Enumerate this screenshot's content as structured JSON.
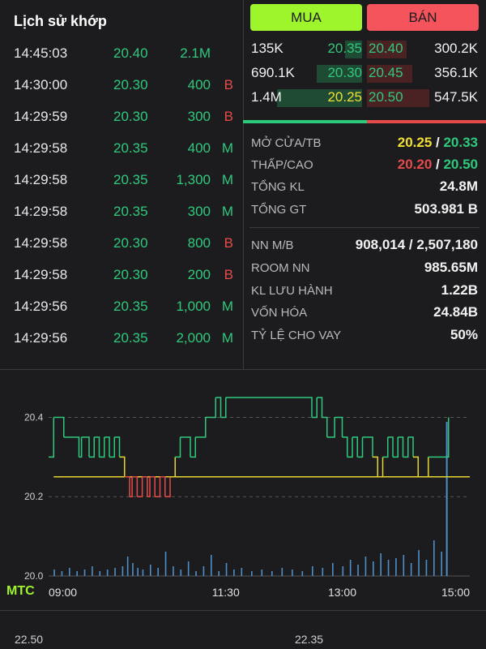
{
  "history": {
    "title": "Lịch sử khớp",
    "rows": [
      {
        "time": "14:45:03",
        "price": "20.40",
        "vol": "2.1M",
        "side": "",
        "vcolor": "green",
        "scolor": ""
      },
      {
        "time": "14:30:00",
        "price": "20.30",
        "vol": "400",
        "side": "B",
        "vcolor": "green",
        "scolor": "red"
      },
      {
        "time": "14:29:59",
        "price": "20.30",
        "vol": "300",
        "side": "B",
        "vcolor": "green",
        "scolor": "red"
      },
      {
        "time": "14:29:58",
        "price": "20.35",
        "vol": "400",
        "side": "M",
        "vcolor": "green",
        "scolor": "green"
      },
      {
        "time": "14:29:58",
        "price": "20.35",
        "vol": "1,300",
        "side": "M",
        "vcolor": "green",
        "scolor": "green"
      },
      {
        "time": "14:29:58",
        "price": "20.35",
        "vol": "300",
        "side": "M",
        "vcolor": "green",
        "scolor": "green"
      },
      {
        "time": "14:29:58",
        "price": "20.30",
        "vol": "800",
        "side": "B",
        "vcolor": "green",
        "scolor": "red"
      },
      {
        "time": "14:29:58",
        "price": "20.30",
        "vol": "200",
        "side": "B",
        "vcolor": "green",
        "scolor": "red"
      },
      {
        "time": "14:29:56",
        "price": "20.35",
        "vol": "1,000",
        "side": "M",
        "vcolor": "green",
        "scolor": "green"
      },
      {
        "time": "14:29:56",
        "price": "20.35",
        "vol": "2,000",
        "side": "M",
        "vcolor": "green",
        "scolor": "green"
      }
    ]
  },
  "buttons": {
    "buy": "MUA",
    "sell": "BÁN"
  },
  "orderbook": [
    {
      "bid_vol": "135K",
      "bid": "20.35",
      "ask": "20.40",
      "ask_vol": "300.2K",
      "bid_bar": 0.15,
      "ask_bar": 0.35
    },
    {
      "bid_vol": "690.1K",
      "bid": "20.30",
      "ask": "20.45",
      "ask_vol": "356.1K",
      "bid_bar": 0.4,
      "ask_bar": 0.4
    },
    {
      "bid_vol": "1.4M",
      "bid": "20.25",
      "ask": "20.50",
      "ask_vol": "547.5K",
      "bid_bar": 0.75,
      "ask_bar": 0.55
    }
  ],
  "stats": {
    "open_avg": {
      "label": "MỞ CỬA/TB",
      "a": "20.25",
      "sep": " / ",
      "b": "20.33"
    },
    "low_high": {
      "label": "THẤP/CAO",
      "a": "20.20",
      "sep": " / ",
      "b": "20.50"
    },
    "total_vol": {
      "label": "TỔNG KL",
      "value": "24.8M"
    },
    "total_val": {
      "label": "TỔNG GT",
      "value": "503.981 B"
    },
    "foreign": {
      "label": "NN M/B",
      "value": "908,014 / 2,507,180"
    },
    "room": {
      "label": "ROOM NN",
      "value": "985.65M"
    },
    "outstanding": {
      "label": "KL LƯU HÀNH",
      "value": "1.22B"
    },
    "market_cap": {
      "label": "VỐN HÓA",
      "value": "24.84B"
    },
    "lending": {
      "label": "TỶ LỆ CHO VAY",
      "value": "50%"
    }
  },
  "chart_data": {
    "type": "line",
    "ylim": [
      20.0,
      20.45
    ],
    "y_ticks": [
      "20.4",
      "20.2",
      "20.0"
    ],
    "x_ticks": [
      "09:00",
      "11:30",
      "13:00",
      "15:00"
    ],
    "reference_price": 20.25,
    "price_series": [
      [
        0,
        20.3
      ],
      [
        2,
        20.4
      ],
      [
        5,
        20.4
      ],
      [
        6,
        20.35
      ],
      [
        10,
        20.35
      ],
      [
        12,
        20.3
      ],
      [
        13,
        20.35
      ],
      [
        16,
        20.3
      ],
      [
        18,
        20.35
      ],
      [
        20,
        20.3
      ],
      [
        22,
        20.35
      ],
      [
        24,
        20.3
      ],
      [
        26,
        20.35
      ],
      [
        28,
        20.3
      ],
      [
        30,
        20.25
      ],
      [
        32,
        20.2
      ],
      [
        33,
        20.25
      ],
      [
        35,
        20.2
      ],
      [
        37,
        20.25
      ],
      [
        39,
        20.2
      ],
      [
        40,
        20.25
      ],
      [
        42,
        20.2
      ],
      [
        44,
        20.25
      ],
      [
        46,
        20.2
      ],
      [
        48,
        20.25
      ],
      [
        50,
        20.3
      ],
      [
        52,
        20.35
      ],
      [
        54,
        20.35
      ],
      [
        56,
        20.3
      ],
      [
        58,
        20.35
      ],
      [
        60,
        20.35
      ],
      [
        62,
        20.4
      ],
      [
        64,
        20.4
      ],
      [
        66,
        20.45
      ],
      [
        68,
        20.4
      ],
      [
        70,
        20.45
      ],
      [
        72,
        20.45
      ],
      [
        100,
        20.45
      ],
      [
        103,
        20.45
      ],
      [
        104,
        20.4
      ],
      [
        106,
        20.45
      ],
      [
        108,
        20.4
      ],
      [
        110,
        20.35
      ],
      [
        113,
        20.4
      ],
      [
        116,
        20.35
      ],
      [
        118,
        20.3
      ],
      [
        120,
        20.35
      ],
      [
        122,
        20.3
      ],
      [
        124,
        20.35
      ],
      [
        128,
        20.3
      ],
      [
        130,
        20.25
      ],
      [
        132,
        20.3
      ],
      [
        134,
        20.35
      ],
      [
        136,
        20.3
      ],
      [
        138,
        20.35
      ],
      [
        140,
        20.3
      ],
      [
        142,
        20.35
      ],
      [
        144,
        20.3
      ],
      [
        146,
        20.25
      ],
      [
        150,
        20.3
      ],
      [
        158,
        20.4
      ]
    ],
    "volume_bars": [
      [
        2,
        4
      ],
      [
        5,
        3
      ],
      [
        8,
        5
      ],
      [
        11,
        3
      ],
      [
        14,
        4
      ],
      [
        17,
        6
      ],
      [
        20,
        3
      ],
      [
        23,
        4
      ],
      [
        26,
        5
      ],
      [
        29,
        6
      ],
      [
        31,
        12
      ],
      [
        33,
        8
      ],
      [
        35,
        5
      ],
      [
        37,
        4
      ],
      [
        40,
        7
      ],
      [
        43,
        5
      ],
      [
        46,
        15
      ],
      [
        49,
        6
      ],
      [
        52,
        4
      ],
      [
        55,
        9
      ],
      [
        58,
        3
      ],
      [
        61,
        6
      ],
      [
        64,
        13
      ],
      [
        67,
        3
      ],
      [
        70,
        8
      ],
      [
        73,
        4
      ],
      [
        76,
        5
      ],
      [
        80,
        3
      ],
      [
        84,
        4
      ],
      [
        88,
        3
      ],
      [
        92,
        5
      ],
      [
        96,
        4
      ],
      [
        100,
        3
      ],
      [
        104,
        6
      ],
      [
        108,
        5
      ],
      [
        112,
        8
      ],
      [
        116,
        6
      ],
      [
        119,
        10
      ],
      [
        122,
        7
      ],
      [
        125,
        12
      ],
      [
        128,
        9
      ],
      [
        131,
        14
      ],
      [
        134,
        10
      ],
      [
        137,
        11
      ],
      [
        140,
        13
      ],
      [
        143,
        8
      ],
      [
        146,
        16
      ],
      [
        149,
        10
      ],
      [
        152,
        22
      ],
      [
        155,
        15
      ],
      [
        157,
        60
      ]
    ]
  },
  "mtc": "MTC",
  "bottom": {
    "left": "22.50",
    "right": "22.35"
  }
}
